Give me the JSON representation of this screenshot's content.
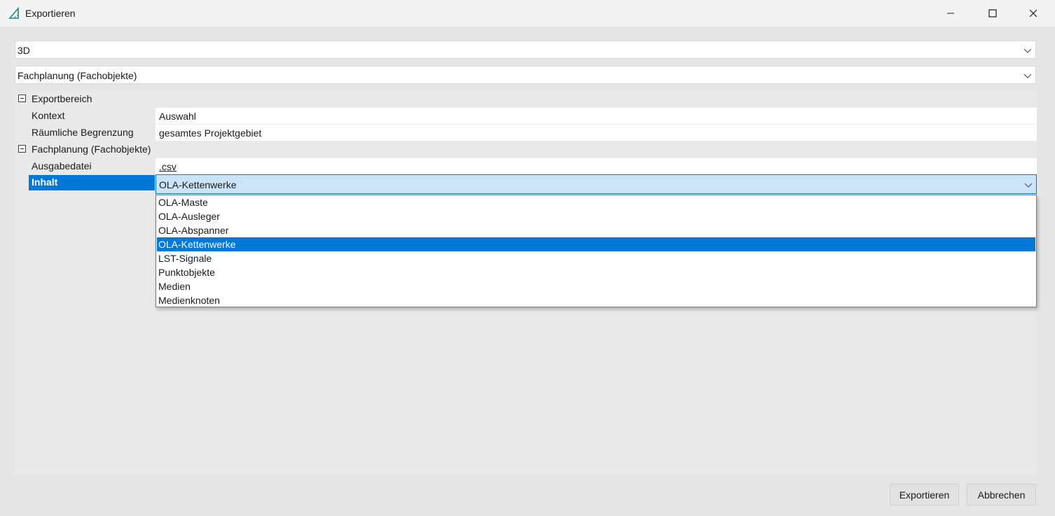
{
  "window": {
    "title": "Exportieren",
    "app_icon": "triangle-ruler-icon",
    "controls": [
      "minimize-icon",
      "maximize-icon",
      "close-icon"
    ]
  },
  "format_combo": {
    "value": "3D"
  },
  "mode_combo": {
    "value": "Fachplanung (Fachobjekte)"
  },
  "properties": {
    "group1": {
      "label": "Exportbereich",
      "rows": [
        {
          "label": "Kontext",
          "value": "Auswahl"
        },
        {
          "label": "Räumliche Begrenzung",
          "value": "gesamtes Projektgebiet"
        }
      ]
    },
    "group2": {
      "label": "Fachplanung (Fachobjekte)",
      "rows": [
        {
          "label": "Ausgabedatei",
          "value": ".csv"
        },
        {
          "label": "Inhalt",
          "value": "OLA-Kettenwerke"
        }
      ]
    }
  },
  "dropdown": {
    "options": [
      "OLA-Maste",
      "OLA-Ausleger",
      "OLA-Abspanner",
      "OLA-Kettenwerke",
      "LST-Signale",
      "Punktobjekte",
      "Medien",
      "Medienknoten"
    ],
    "selected": "OLA-Kettenwerke"
  },
  "buttons": {
    "export": "Exportieren",
    "cancel": "Abbrechen"
  },
  "colors": {
    "accent": "#0078d7",
    "selection_bg": "#cce4f7",
    "icon_teal": "#1a8a8a"
  }
}
